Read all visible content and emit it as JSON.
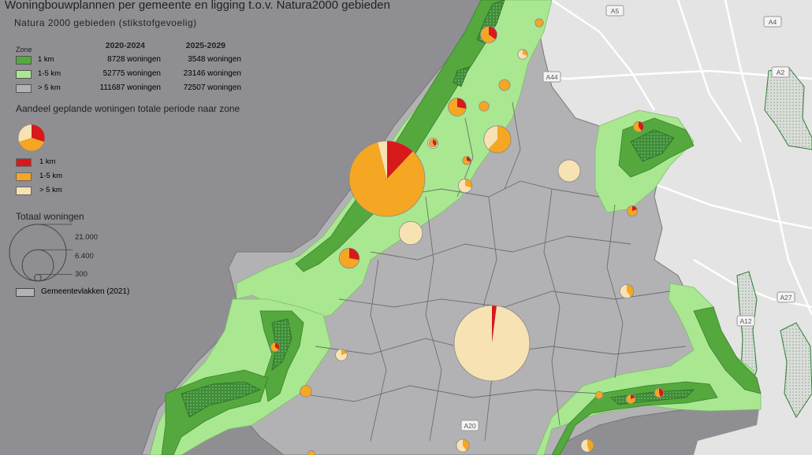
{
  "legend": {
    "title": "Woningbouwplannen per gemeente en ligging t.o.v. Natura2000 gebieden",
    "subtitle": "Natura 2000 gebieden (stikstofgevoelig)",
    "zone_label": "Zone",
    "columns": [
      "2020-2024",
      "2025-2029"
    ],
    "zones": [
      {
        "name": "1 km",
        "color": "#55a83e",
        "v2020": "8728 woningen",
        "v2025": "3548 woningen"
      },
      {
        "name": "1-5 km",
        "color": "#a9e891",
        "v2020": "52775 woningen",
        "v2025": "23146 woningen"
      },
      {
        "name": "> 5 km",
        "color": "#b2b2b4",
        "v2020": "111687 woningen",
        "v2025": "72507 woningen"
      }
    ],
    "share_title": "Aandeel geplande woningen totale periode naar zone",
    "share_classes": [
      {
        "name": "1 km",
        "color": "#d7191c"
      },
      {
        "name": "1-5 km",
        "color": "#f5a623"
      },
      {
        "name": "> 5 km",
        "color": "#f7e2b4"
      }
    ],
    "total_title": "Totaal woningen",
    "size_classes": [
      {
        "label": "21.000",
        "value": 21000
      },
      {
        "label": "6.400",
        "value": 6400
      },
      {
        "label": "300",
        "value": 300
      }
    ],
    "municipality_label": "Gemeentevlakken (2021)"
  },
  "road_labels": [
    "A5",
    "A4",
    "A44",
    "A2",
    "A27",
    "A12",
    "A20"
  ],
  "chart_data": {
    "type": "map-pie",
    "legend": {
      "placement": "top-left"
    },
    "pies": [
      {
        "total": 21000,
        "shares": [
          0.12,
          0.84,
          0.04
        ]
      },
      {
        "total": 21000,
        "shares": [
          0.02,
          0.0,
          0.98
        ]
      },
      {
        "total": 2700,
        "shares": [
          0.0,
          0.62,
          0.38
        ]
      },
      {
        "total": 2000,
        "shares": [
          0.0,
          0.0,
          1.0
        ]
      },
      {
        "total": 1800,
        "shares": [
          0.0,
          0.0,
          1.0
        ]
      },
      {
        "total": 1500,
        "shares": [
          0.28,
          0.72,
          0.0
        ]
      },
      {
        "total": 1200,
        "shares": [
          0.28,
          0.72,
          0.0
        ]
      },
      {
        "total": 1000,
        "shares": [
          0.35,
          0.65,
          0.0
        ]
      },
      {
        "total": 700,
        "shares": [
          0.0,
          0.3,
          0.7
        ]
      },
      {
        "total": 700,
        "shares": [
          0.0,
          0.4,
          0.6
        ]
      },
      {
        "total": 600,
        "shares": [
          0.0,
          0.45,
          0.55
        ]
      },
      {
        "total": 600,
        "shares": [
          0.0,
          0.4,
          0.6
        ]
      },
      {
        "total": 500,
        "shares": [
          0.0,
          0.2,
          0.8
        ]
      },
      {
        "total": 500,
        "shares": [
          0.0,
          1.0,
          0.0
        ]
      },
      {
        "total": 450,
        "shares": [
          0.0,
          1.0,
          0.0
        ]
      },
      {
        "total": 400,
        "shares": [
          0.4,
          0.6,
          0.0
        ]
      },
      {
        "total": 400,
        "shares": [
          0.2,
          0.8,
          0.0
        ]
      },
      {
        "total": 400,
        "shares": [
          0.0,
          0.3,
          0.7
        ]
      },
      {
        "total": 350,
        "shares": [
          0.0,
          1.0,
          0.0
        ]
      },
      {
        "total": 350,
        "shares": [
          0.0,
          0.3,
          0.7
        ]
      },
      {
        "total": 300,
        "shares": [
          0.35,
          0.65,
          0.0
        ]
      },
      {
        "total": 300,
        "shares": [
          0.45,
          0.55,
          0.0
        ]
      },
      {
        "total": 300,
        "shares": [
          0.2,
          0.8,
          0.0
        ]
      },
      {
        "total": 250,
        "shares": [
          0.0,
          1.0,
          0.0
        ]
      },
      {
        "total": 250,
        "shares": [
          0.3,
          0.7,
          0.0
        ]
      },
      {
        "total": 200,
        "shares": [
          0.4,
          0.6,
          0.0
        ]
      },
      {
        "total": 200,
        "shares": [
          0.0,
          1.0,
          0.0
        ]
      },
      {
        "total": 200,
        "shares": [
          0.0,
          1.0,
          0.0
        ]
      }
    ]
  }
}
